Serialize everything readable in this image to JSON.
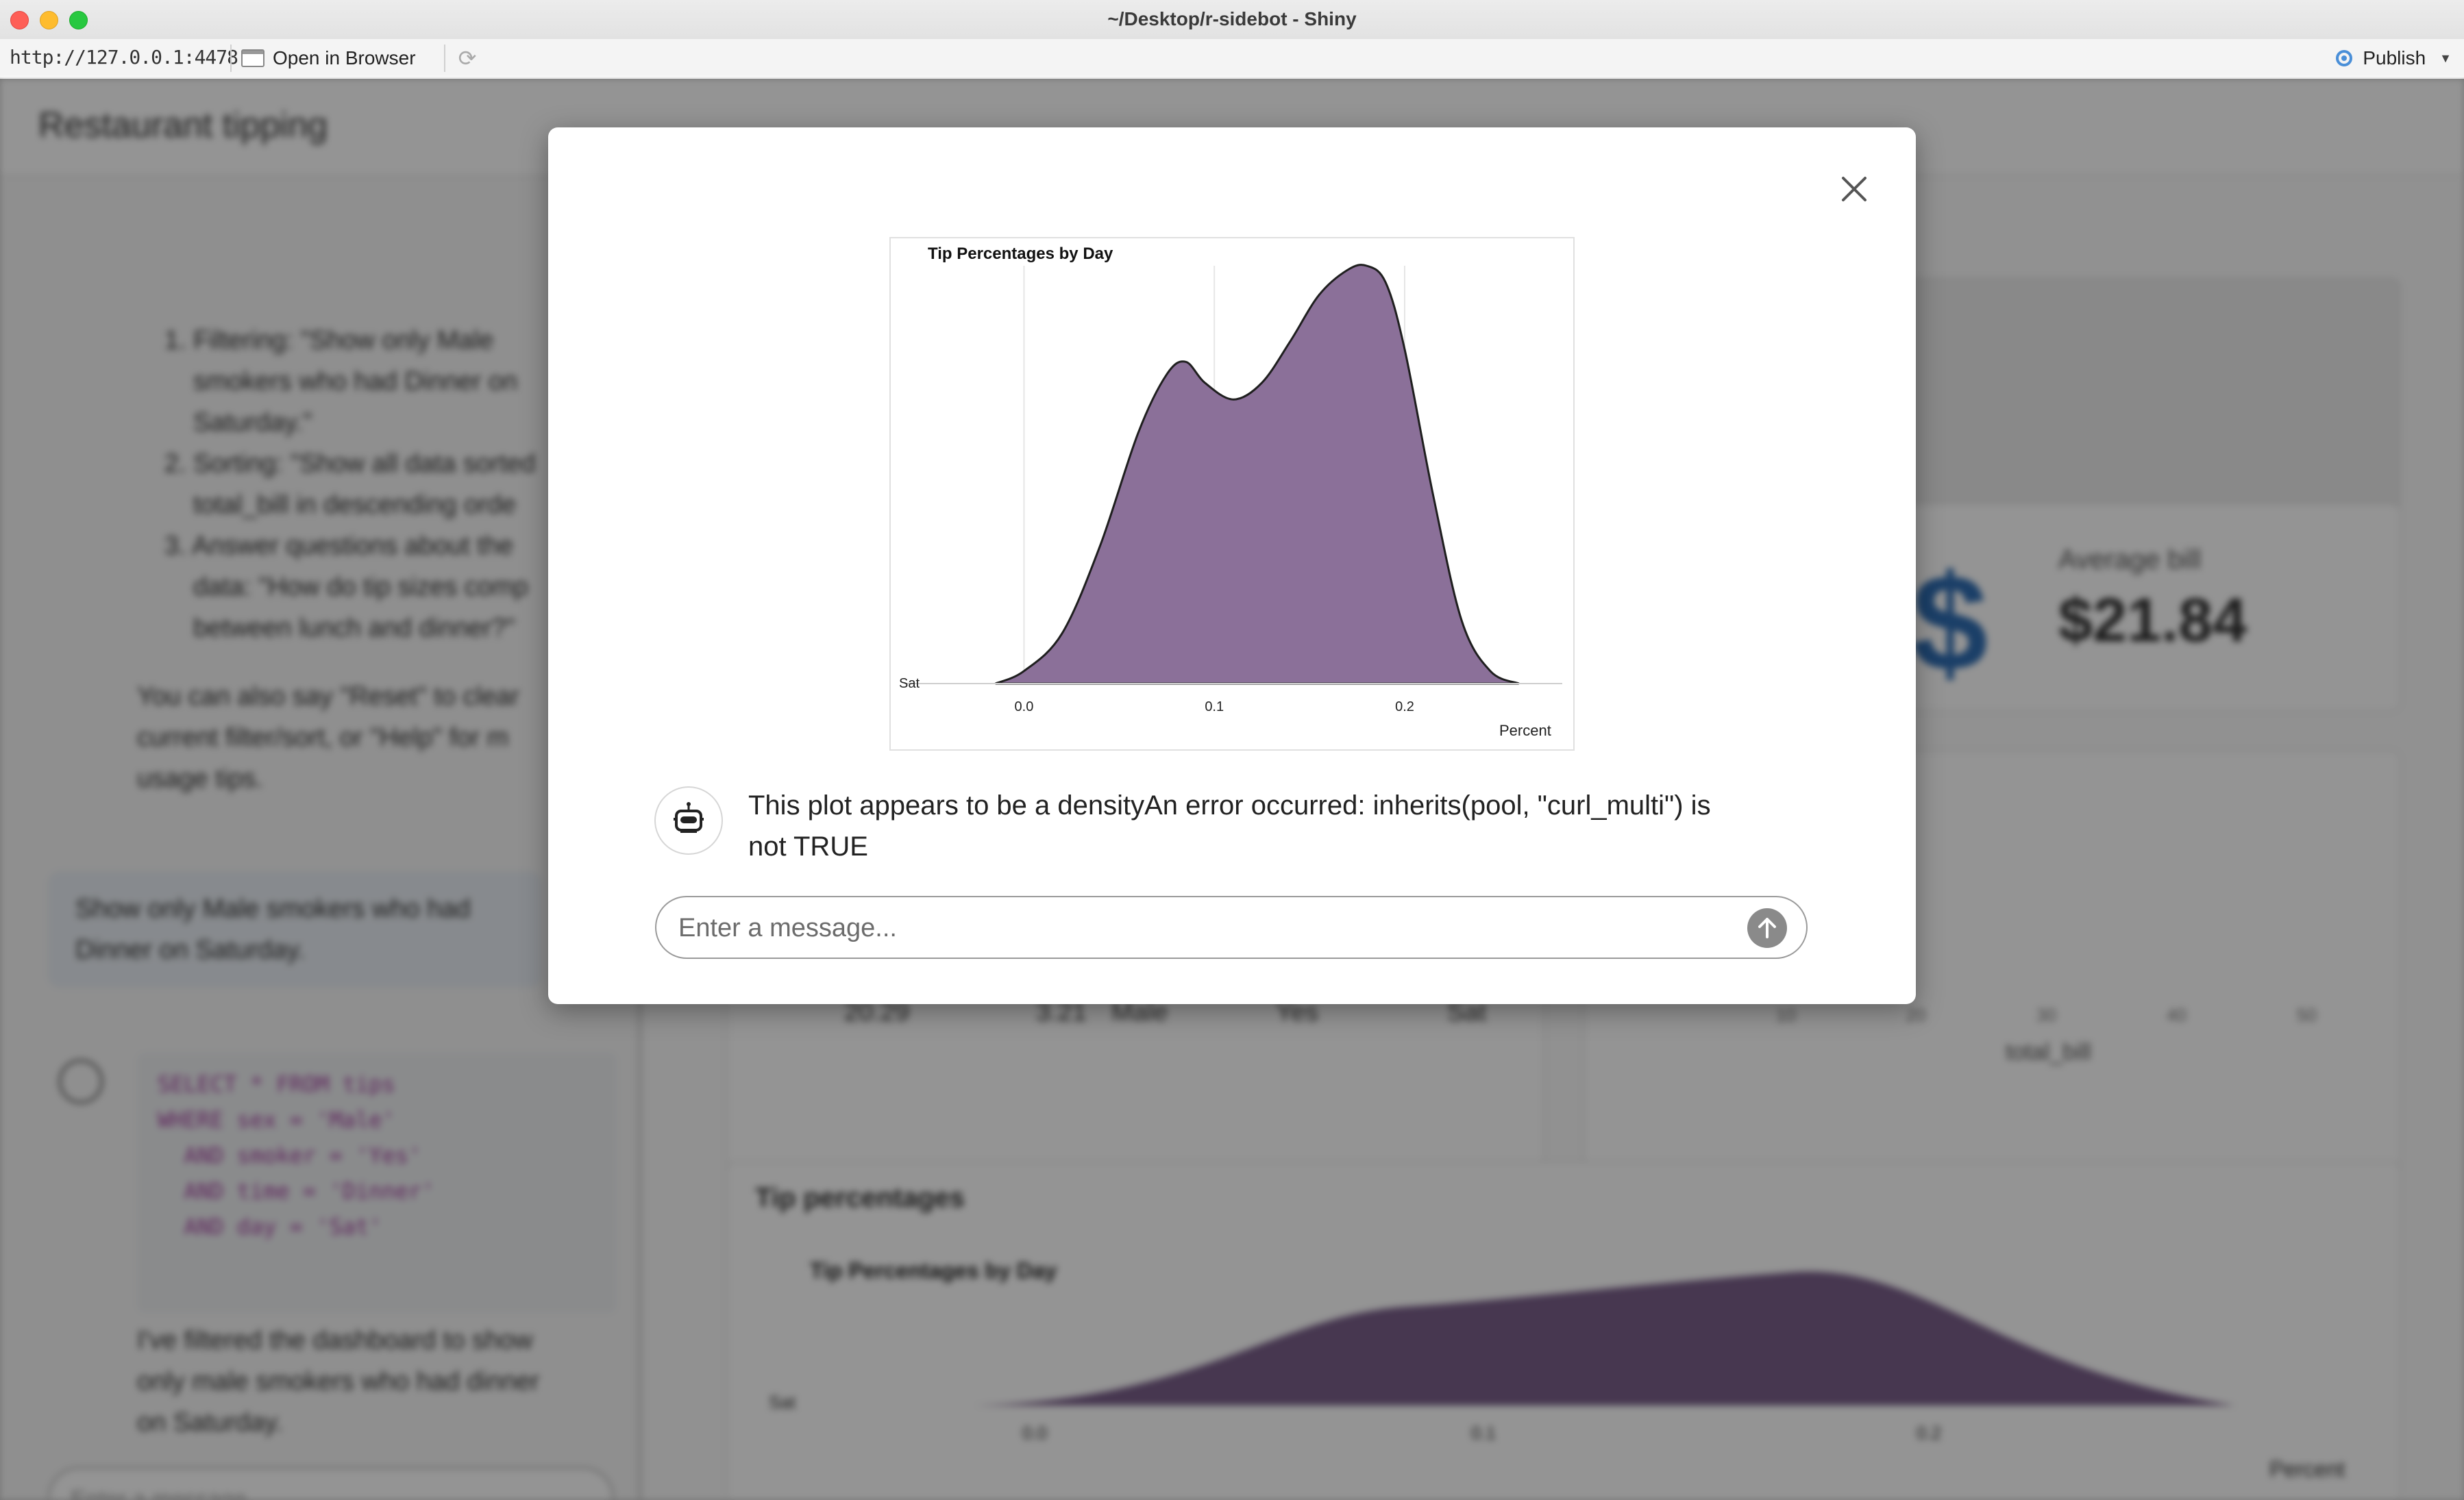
{
  "window": {
    "title": "~/Desktop/r-sidebot - Shiny",
    "url": "http://127.0.0.1:4478",
    "open_in_browser": "Open in Browser",
    "publish": "Publish"
  },
  "background_app": {
    "title": "Restaurant tipping",
    "sidebar": {
      "list_items": [
        "1. Filtering: \"Show only Male",
        "smokers who had Dinner on",
        "Saturday.\"",
        "2. Sorting: \"Show all data sorted",
        "total_bill in descending orde",
        "3. Answer questions about the",
        "data: \"How do tip sizes comp",
        "between lunch and dinner?\""
      ],
      "help_text_lines": [
        "You can also say \"Reset\" to clear",
        "current filter/sort, or \"Help\" for m",
        "usage tips."
      ],
      "user_message_lines": [
        "Show only Male smokers who had",
        "Dinner on Saturday."
      ],
      "sql_lines": [
        "SELECT * FROM tips",
        "WHERE sex = 'Male'",
        "  AND smoker = 'Yes'",
        "  AND time = 'Dinner'",
        "  AND day = 'Sat'"
      ],
      "reply_lines": [
        "I've filtered the dashboard to show",
        "only male smokers who had dinner",
        "on Saturday."
      ],
      "input_placeholder": "Enter a message..."
    },
    "kpi": {
      "label": "Average bill",
      "value": "$21.84"
    },
    "table_row": [
      "20.29",
      "3.21",
      "Male",
      "Yes",
      "Sat"
    ],
    "scatter_xlabel": "total_bill",
    "scatter_ticks": [
      "10",
      "20",
      "30",
      "40",
      "50"
    ],
    "tip_card_title": "Tip percentages",
    "tip_plot_title": "Tip Percentages by Day",
    "tip_plot_ylabel": "Sat",
    "tip_plot_ticks": [
      "0.0",
      "0.1",
      "0.2"
    ],
    "tip_plot_xlabel": "Percent"
  },
  "modal": {
    "message": "This plot appears to be a densityAn error occurred: inherits(pool, \"curl_multi\") is not TRUE",
    "input_placeholder": "Enter a message...",
    "icons": {
      "close": "close-icon",
      "send": "arrow-up-icon",
      "bot": "robot-icon"
    }
  },
  "chart_data": {
    "type": "area",
    "title": "Tip Percentages by Day",
    "xlabel": "Percent",
    "ylabel": "",
    "categories": [
      "Sat"
    ],
    "x_ticks": [
      "0.0",
      "0.1",
      "0.2"
    ],
    "xlim": [
      -0.07,
      0.29
    ],
    "fill_color": "#8b7099",
    "series": [
      {
        "name": "Sat",
        "x": [
          -0.015,
          0.0,
          0.02,
          0.04,
          0.06,
          0.075,
          0.085,
          0.095,
          0.11,
          0.125,
          0.14,
          0.155,
          0.17,
          0.18,
          0.19,
          0.2,
          0.215,
          0.23,
          0.245,
          0.26
        ],
        "y": [
          0.0,
          0.03,
          0.12,
          0.33,
          0.6,
          0.74,
          0.77,
          0.72,
          0.68,
          0.72,
          0.82,
          0.93,
          0.99,
          1.0,
          0.96,
          0.8,
          0.45,
          0.15,
          0.03,
          0.0
        ]
      }
    ]
  }
}
